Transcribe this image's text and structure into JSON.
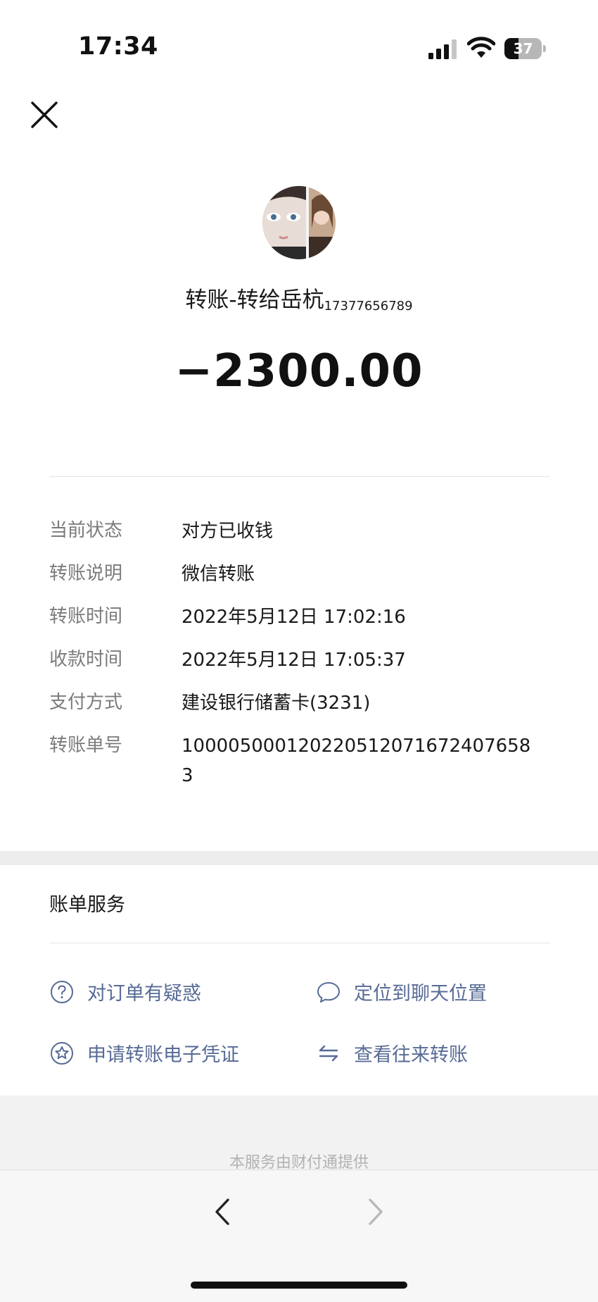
{
  "status_bar": {
    "time": "17:34",
    "battery_level": "37",
    "icons": [
      "signal-icon",
      "wifi-icon",
      "battery-icon"
    ]
  },
  "header": {
    "close_icon": "close-icon"
  },
  "transfer": {
    "title": "转账-转给岳杭",
    "phone": "17377656789",
    "amount": "−2300.00"
  },
  "details": [
    {
      "label": "当前状态",
      "value": "对方已收钱"
    },
    {
      "label": "转账说明",
      "value": "微信转账"
    },
    {
      "label": "转账时间",
      "value": "2022年5月12日 17:02:16"
    },
    {
      "label": "收款时间",
      "value": "2022年5月12日 17:05:37"
    },
    {
      "label": "支付方式",
      "value": "建设银行储蓄卡(3231)"
    },
    {
      "label": "转账单号",
      "value": "100005000120220512071672407658 3"
    }
  ],
  "services": {
    "title": "账单服务",
    "items": [
      {
        "label": "对订单有疑惑",
        "icon": "question-circle-icon"
      },
      {
        "label": "定位到聊天位置",
        "icon": "chat-bubble-icon"
      },
      {
        "label": "申请转账电子凭证",
        "icon": "star-circle-icon"
      },
      {
        "label": "查看往来转账",
        "icon": "exchange-arrows-icon"
      }
    ]
  },
  "footer": {
    "provider_text": "本服务由财付通提供"
  },
  "colors": {
    "link": "#576b95",
    "label_gray": "#7b7b7b",
    "text": "#191919",
    "band": "#ededed"
  }
}
